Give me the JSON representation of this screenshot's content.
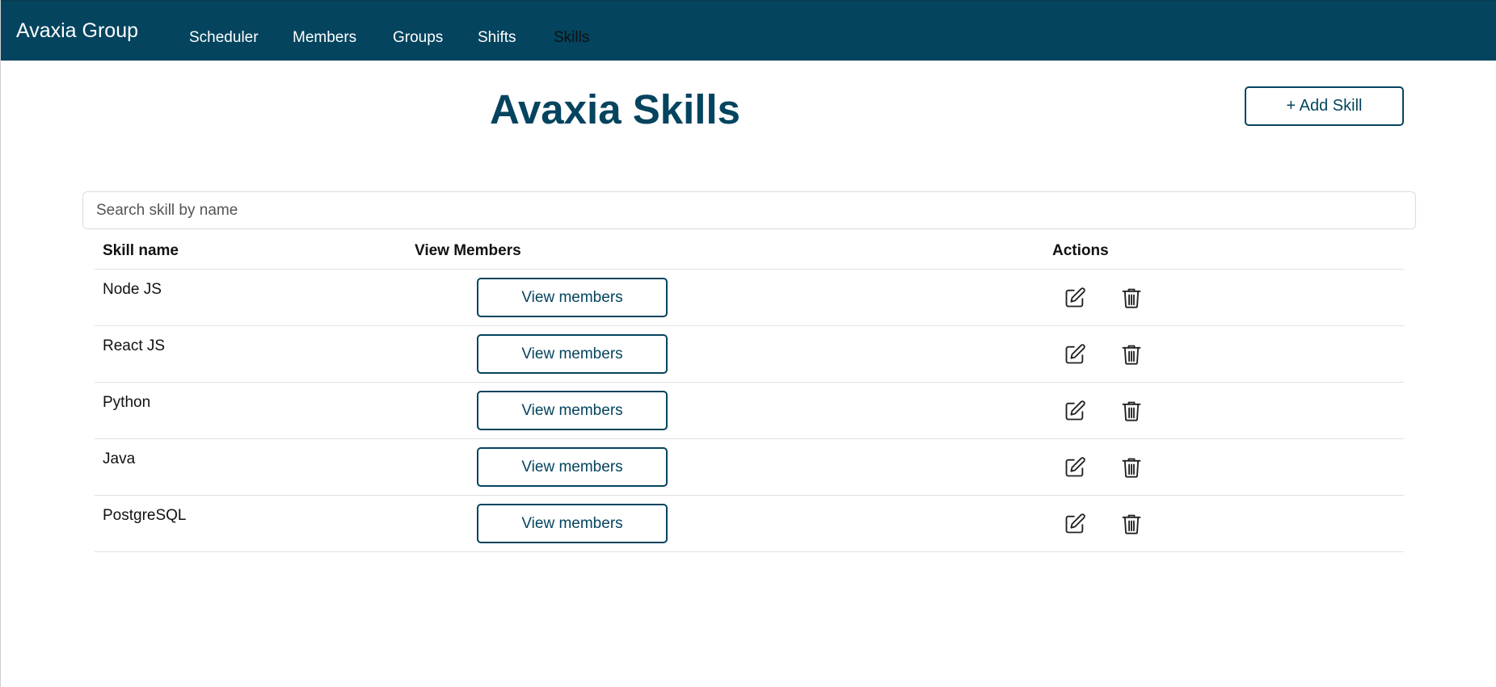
{
  "navbar": {
    "brand": "Avaxia Group",
    "links": [
      {
        "label": "Scheduler"
      },
      {
        "label": "Members"
      },
      {
        "label": "Groups"
      },
      {
        "label": "Shifts"
      },
      {
        "label": "Skills",
        "active": true
      }
    ]
  },
  "page": {
    "title": "Avaxia Skills",
    "add_button_label": "+ Add Skill"
  },
  "search": {
    "placeholder": "Search skill by name",
    "value": ""
  },
  "table": {
    "headers": {
      "skill_name": "Skill name",
      "view_members": "View Members",
      "actions": "Actions"
    },
    "rows": [
      {
        "name": "Node JS",
        "view_label": "View members"
      },
      {
        "name": "React JS",
        "view_label": "View members"
      },
      {
        "name": "Python",
        "view_label": "View members"
      },
      {
        "name": "Java",
        "view_label": "View members"
      },
      {
        "name": "PostgreSQL",
        "view_label": "View members"
      }
    ],
    "row_icons": [
      "edit-icon",
      "trash-icon"
    ]
  },
  "colors": {
    "brand": "#04445e",
    "active_link": "#111111"
  }
}
